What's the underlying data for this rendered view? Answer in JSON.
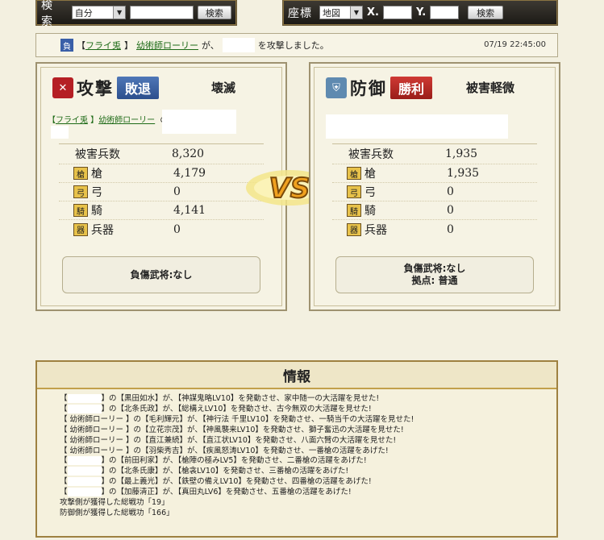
{
  "search": {
    "title": "検索",
    "select": "自分",
    "button": "検索"
  },
  "coords": {
    "title": "座標",
    "select": "地図",
    "x_label": "X.",
    "y_label": "Y.",
    "button": "検索"
  },
  "news": {
    "outcome": "負",
    "prefix": "【",
    "alliance": "フライ兎",
    "sep": "】",
    "player": "幼術師ローリー",
    "mid": "が、",
    "suffix": "を攻撃しました。",
    "time": "07/19 22:45:00"
  },
  "attack": {
    "badge": "攻撃",
    "result": "敗退",
    "status": "壊滅",
    "alliance": "フライ兎",
    "player": "幼術師ローリー",
    "no": "の",
    "dmg_label": "被害兵数",
    "dmg_total": "8,320",
    "units": [
      {
        "icon": "spear-icon",
        "label": "槍",
        "value": "4,179"
      },
      {
        "icon": "bow-icon",
        "label": "弓",
        "value": "0"
      },
      {
        "icon": "horse-icon",
        "label": "騎",
        "value": "4,141"
      },
      {
        "icon": "weapon-icon",
        "label": "兵器",
        "value": "0"
      }
    ],
    "injured": "負傷武将:なし"
  },
  "defense": {
    "badge": "防御",
    "result": "勝利",
    "status": "被害軽微",
    "dmg_label": "被害兵数",
    "dmg_total": "1,935",
    "units": [
      {
        "icon": "spear-icon",
        "label": "槍",
        "value": "1,935"
      },
      {
        "icon": "bow-icon",
        "label": "弓",
        "value": "0"
      },
      {
        "icon": "horse-icon",
        "label": "騎",
        "value": "0"
      },
      {
        "icon": "weapon-icon",
        "label": "兵器",
        "value": "0"
      }
    ],
    "injured": "負傷武将:なし",
    "base": "拠点: 普通"
  },
  "vs": "VS",
  "info": {
    "title": "情報",
    "lines": [
      {
        "a": "【",
        "b": "】の【黒田如水】が、【神謀鬼略LV10】を発動させ、家中随一の大活躍を見せた!"
      },
      {
        "a": "【",
        "b": "】の【北条氏政】が、【総構えLV10】を発動させ、古今無双の大活躍を見せた!"
      },
      {
        "a": "【 幼術師ローリー 】の【毛利輝元】が、【神行法 千里LV10】を発動させ、一騎当千の大活躍を見せた!"
      },
      {
        "a": "【 幼術師ローリー 】の【立花宗茂】が、【神風襲来LV10】を発動させ、獅子奮迅の大活躍を見せた!"
      },
      {
        "a": "【 幼術師ローリー 】の【直江兼続】が、【直江状LV10】を発動させ、八面六臂の大活躍を見せた!"
      },
      {
        "a": "【 幼術師ローリー 】の【羽柴秀吉】が、【疾風怒涛LV10】を発動させ、一番槍の活躍をあげた!"
      },
      {
        "a": "【",
        "b": "】の【前田利家】が、【槍陣の極みLV5】を発動させ、二番槍の活躍をあげた!"
      },
      {
        "a": "【",
        "b": "】の【北条氏康】が、【槍衾LV10】を発動させ、三番槍の活躍をあげた!"
      },
      {
        "a": "【",
        "b": "】の【最上義光】が、【鉄壁の備えLV10】を発動させ、四番槍の活躍をあげた!"
      },
      {
        "a": "【",
        "b": "】の【加藤清正】が、【真田丸LV6】を発動させ、五番槍の活躍をあげた!"
      },
      {
        "a": "攻撃側が獲得した総戦功「19」"
      },
      {
        "a": "防御側が獲得した総戦功「166」"
      }
    ]
  }
}
